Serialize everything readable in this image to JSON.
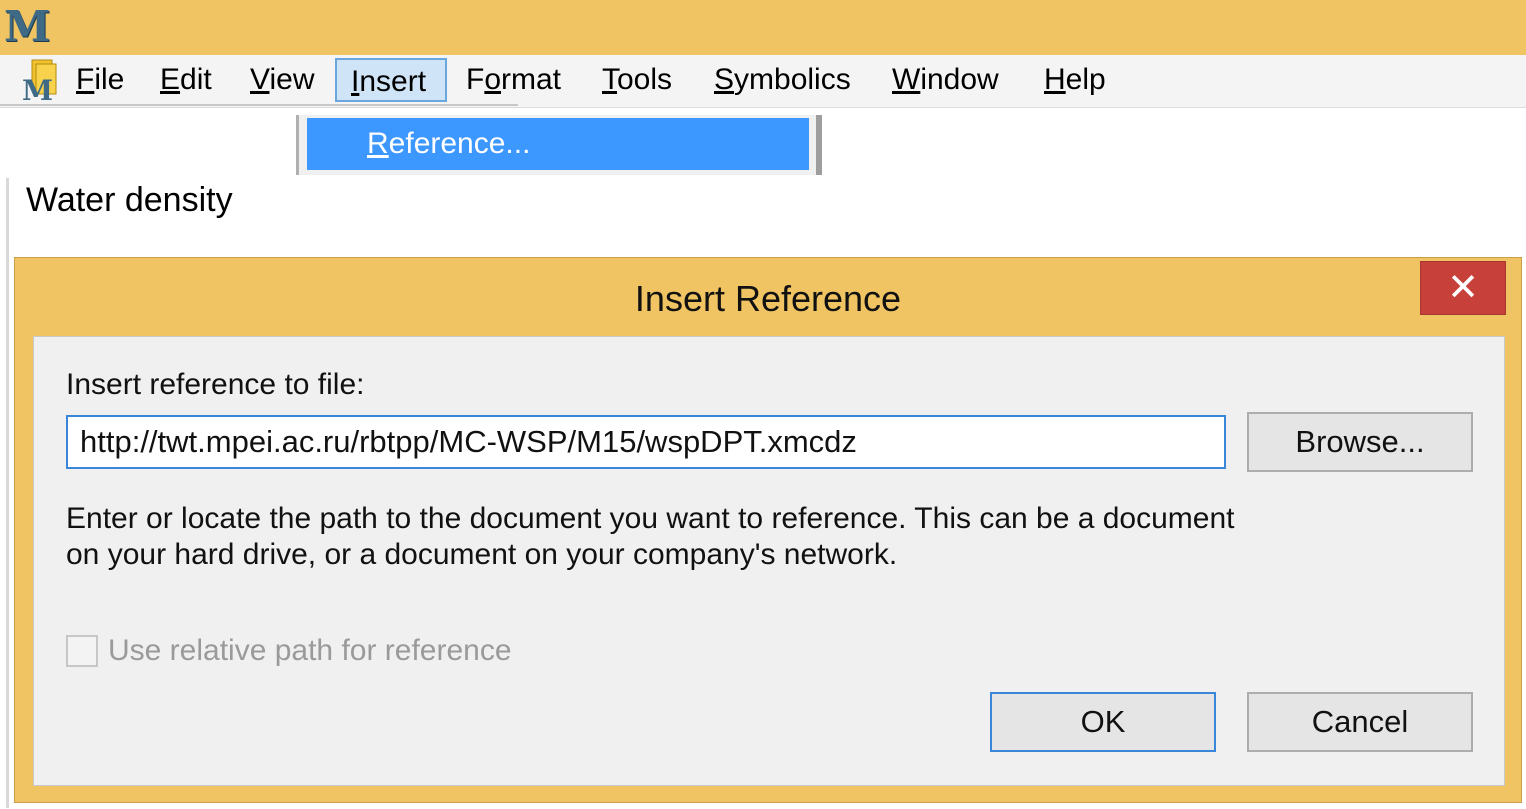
{
  "app": {
    "logo_letter": "M"
  },
  "menubar": {
    "items": [
      {
        "label": "File",
        "key": "F"
      },
      {
        "label": "Edit",
        "key": "E"
      },
      {
        "label": "View",
        "key": "V"
      },
      {
        "label": "Insert",
        "key": "I"
      },
      {
        "label": "Format",
        "key": "o"
      },
      {
        "label": "Tools",
        "key": "T"
      },
      {
        "label": "Symbolics",
        "key": "S"
      },
      {
        "label": "Window",
        "key": "W"
      },
      {
        "label": "Help",
        "key": "H"
      }
    ],
    "active_item": "Insert"
  },
  "insert_menu": {
    "items": [
      {
        "label": "Reference...",
        "highlighted": true
      }
    ]
  },
  "document": {
    "text": "Water density"
  },
  "dialog": {
    "title": "Insert Reference",
    "close_symbol": "✕",
    "file_label": "Insert reference to file:",
    "file_value": "http://twt.mpei.ac.ru/rbtpp/MC-WSP/M15/wspDPT.xmcdz",
    "browse_label": "Browse...",
    "description_line1": "Enter or locate the path to the document you want to reference. This can be a document",
    "description_line2": "on your hard drive, or a document on your company's network.",
    "relative_path_label": "Use relative path for reference",
    "relative_path_checked": false,
    "relative_path_enabled": false,
    "ok_label": "OK",
    "cancel_label": "Cancel"
  },
  "colors": {
    "titlebar": "#f0c462",
    "menu_highlight": "#3c97ff",
    "close_button": "#c8403a",
    "focus_border": "#3a87d9"
  }
}
